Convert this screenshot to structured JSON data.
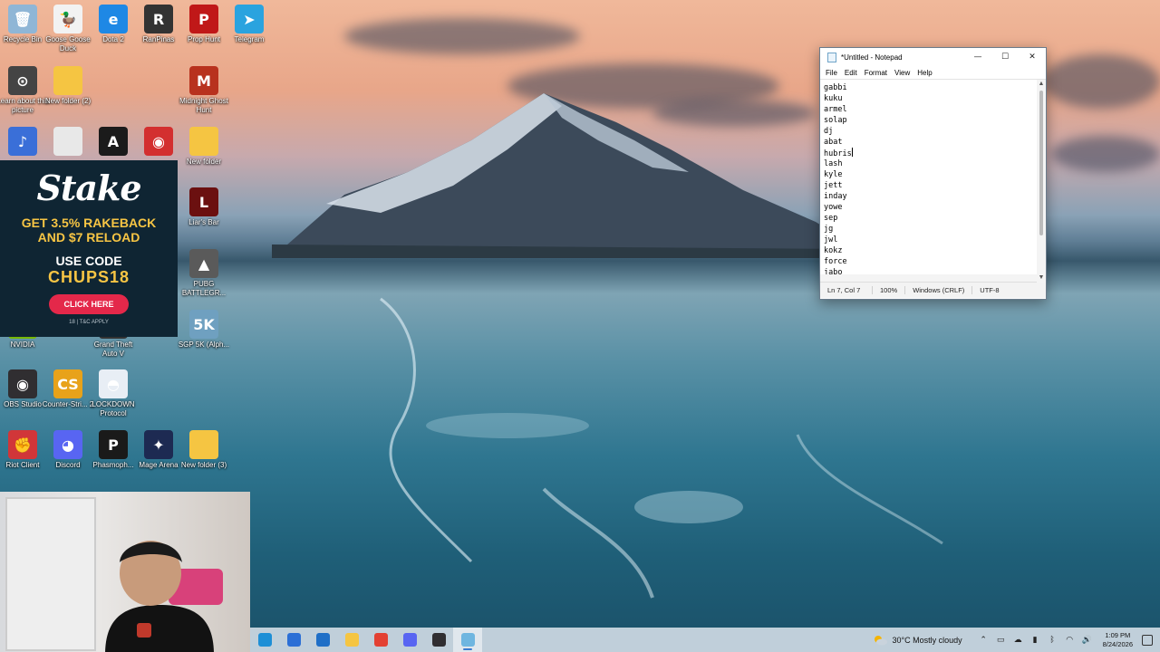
{
  "desktop": {
    "icons": [
      {
        "id": "recycle-bin",
        "label": "Recycle Bin",
        "glyph": "🗑",
        "color": "#8fb6d6"
      },
      {
        "id": "goose-goose-duck",
        "label": "Goose Goose Duck",
        "glyph": "🦆",
        "color": "#f2f2f2"
      },
      {
        "id": "dota2",
        "label": "Dota 2",
        "glyph": "e",
        "color": "#1e88e5"
      },
      {
        "id": "ranpinas",
        "label": "RanPinas",
        "glyph": "R",
        "color": "#333333"
      },
      {
        "id": "prop-hunt",
        "label": "Prop Hunt",
        "glyph": "P",
        "color": "#c01818"
      },
      {
        "id": "telegram",
        "label": "Telegram",
        "glyph": "➤",
        "color": "#2aa3df"
      },
      {
        "id": "learn-about-picture",
        "label": "Learn about this picture",
        "glyph": "⊙",
        "color": "#444444"
      },
      {
        "id": "new-folder-2",
        "label": "New folder (2)",
        "glyph": "",
        "color": "#f5c542"
      },
      {
        "id": "midnight-ghost-hunt",
        "label": "Midnight Ghost Hunt",
        "glyph": "M",
        "color": "#b8321e"
      },
      {
        "id": "sound-app",
        "label": "",
        "glyph": "♪",
        "color": "#3a6fd8"
      },
      {
        "id": "doc-file",
        "label": "",
        "glyph": "",
        "color": "#e8e8e8"
      },
      {
        "id": "app-a",
        "label": "",
        "glyph": "A",
        "color": "#1b1b1b"
      },
      {
        "id": "among-us",
        "label": "",
        "glyph": "◉",
        "color": "#d32f2f"
      },
      {
        "id": "new-folder",
        "label": "New folder",
        "glyph": "",
        "color": "#f5c542"
      },
      {
        "id": "liars-bar",
        "label": "Liar's Bar",
        "glyph": "L",
        "color": "#6b1010"
      },
      {
        "id": "pubg",
        "label": "PUBG BATTLEGR...",
        "glyph": "▲",
        "color": "#5a5a5a"
      },
      {
        "id": "sgp-5k",
        "label": "SGP 5K (Alph...",
        "glyph": "5K",
        "color": "#6fa0c0"
      },
      {
        "id": "nvidia",
        "label": "NVIDIA",
        "glyph": "",
        "color": "#76b900"
      },
      {
        "id": "gta-v",
        "label": "Grand Theft Auto V",
        "glyph": "",
        "color": "#333333"
      },
      {
        "id": "obs-studio",
        "label": "OBS Studio",
        "glyph": "◉",
        "color": "#302e31"
      },
      {
        "id": "counter-strike-2",
        "label": "Counter-Stri... 2",
        "glyph": "CS",
        "color": "#e8a21a"
      },
      {
        "id": "lockdown-protocol",
        "label": "LOCKDOWN Protocol",
        "glyph": "◓",
        "color": "#e8eef5"
      },
      {
        "id": "riot-client",
        "label": "Riot Client",
        "glyph": "✊",
        "color": "#d13639"
      },
      {
        "id": "discord",
        "label": "Discord",
        "glyph": "◕",
        "color": "#5865f2"
      },
      {
        "id": "phasmophobia",
        "label": "Phasmoph...",
        "glyph": "P",
        "color": "#1a1a1a"
      },
      {
        "id": "mage-arena",
        "label": "Mage Arena",
        "glyph": "✦",
        "color": "#1d2a52"
      },
      {
        "id": "new-folder-3",
        "label": "New folder (3)",
        "glyph": "",
        "color": "#f5c542"
      }
    ]
  },
  "ad": {
    "brand": "Stake",
    "promo_line1": "GET 3.5% RAKEBACK",
    "promo_line2": "AND $7 RELOAD",
    "use_code": "USE CODE",
    "code": "CHUPS18",
    "button": "CLICK HERE",
    "fine_print": "18 | T&C APPLY"
  },
  "notepad": {
    "title": "*Untitled - Notepad",
    "menu": [
      "File",
      "Edit",
      "Format",
      "View",
      "Help"
    ],
    "lines": [
      "gabbi",
      "kuku",
      "armel",
      "solap",
      "dj",
      "abat",
      "hubris",
      "lash",
      "kyle",
      "jett",
      "inday",
      "yowe",
      "sep",
      "jg",
      "jwl",
      "kokz",
      "force",
      "jabo"
    ],
    "caret_line": 6,
    "status": {
      "position": "Ln 7, Col 7",
      "zoom": "100%",
      "line_ending": "Windows (CRLF)",
      "encoding": "UTF-8"
    }
  },
  "taskbar": {
    "apps": [
      {
        "id": "edge",
        "color": "#1d8fd6",
        "active": false
      },
      {
        "id": "store",
        "color": "#2b6fd6",
        "active": false
      },
      {
        "id": "outlook",
        "color": "#1f6fc7",
        "active": false
      },
      {
        "id": "file-explorer",
        "color": "#f5c542",
        "active": false
      },
      {
        "id": "chrome",
        "color": "#e34133",
        "active": false
      },
      {
        "id": "discord",
        "color": "#5865f2",
        "active": false
      },
      {
        "id": "obs",
        "color": "#302e31",
        "active": false
      },
      {
        "id": "notepad",
        "color": "#6fb6e0",
        "active": true
      }
    ],
    "weather": {
      "temp": "30°C",
      "condition": "Mostly cloudy"
    },
    "clock": {
      "time": "1:09 PM",
      "date": "8/24/2026"
    }
  }
}
